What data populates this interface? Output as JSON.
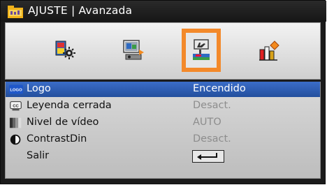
{
  "window": {
    "title": "AJUSTE | Avanzada",
    "title_icon": "setup-folder-icon"
  },
  "tabs": [
    {
      "name": "image-settings",
      "icon": "image-settings-icon",
      "selected": false
    },
    {
      "name": "display",
      "icon": "display-settings-icon",
      "selected": false
    },
    {
      "name": "setup",
      "icon": "setup-hand-icon",
      "selected": true
    },
    {
      "name": "options",
      "icon": "options-icon",
      "selected": false
    }
  ],
  "menu": {
    "items": [
      {
        "label": "Logo",
        "value": "Encendido",
        "icon": "logo-icon"
      },
      {
        "label": "Leyenda cerrada",
        "value": "Desact.",
        "icon": "closed-caption-icon"
      },
      {
        "label": "Nivel de vídeo",
        "value": "AUTO",
        "icon": "video-level-icon"
      },
      {
        "label": "ContrastDin",
        "value": "Desact.",
        "icon": "contrast-icon"
      },
      {
        "label": "Salir",
        "value": "",
        "icon": "none"
      }
    ],
    "logo_badge_text": "LOGO",
    "exit_icon": "enter-key-icon"
  },
  "colors": {
    "accent_orange": "#f3892a",
    "value_gray": "#8d8d8d",
    "background_dark": "#1b1b1b"
  }
}
